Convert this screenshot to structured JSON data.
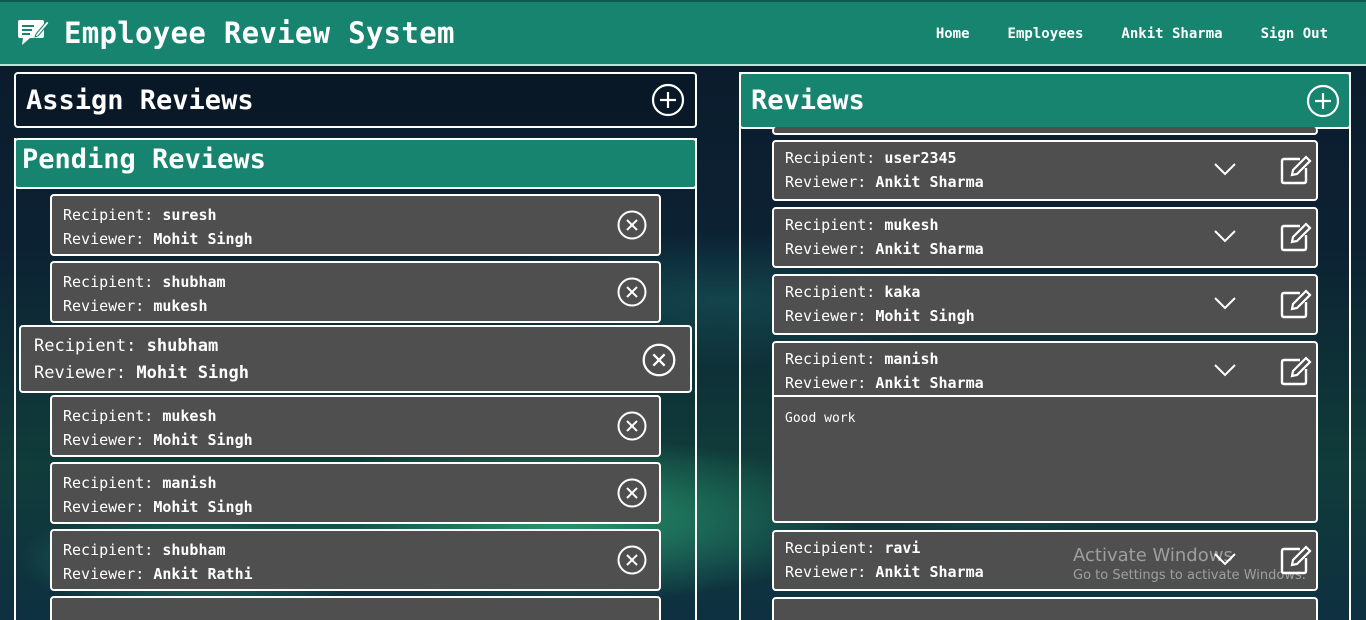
{
  "header": {
    "title": "Employee Review System",
    "nav": [
      "Home",
      "Employees",
      "Ankit Sharma",
      "Sign Out"
    ]
  },
  "assign": {
    "title": "Assign Reviews"
  },
  "pending": {
    "title": "Pending Reviews",
    "recipient_label": "Recipient:",
    "reviewer_label": "Reviewer:",
    "items": [
      {
        "recipient": "suresh",
        "reviewer": "Mohit Singh"
      },
      {
        "recipient": "shubham",
        "reviewer": "mukesh"
      },
      {
        "recipient": "shubham",
        "reviewer": "Mohit Singh"
      },
      {
        "recipient": "mukesh",
        "reviewer": "Mohit Singh"
      },
      {
        "recipient": "manish",
        "reviewer": "Mohit Singh"
      },
      {
        "recipient": "shubham",
        "reviewer": "Ankit Rathi"
      }
    ]
  },
  "reviews": {
    "title": "Reviews",
    "recipient_label": "Recipient:",
    "reviewer_label": "Reviewer:",
    "items": [
      {
        "recipient": "user2345",
        "reviewer": "Ankit Sharma"
      },
      {
        "recipient": "mukesh",
        "reviewer": "Ankit Sharma"
      },
      {
        "recipient": "kaka",
        "reviewer": "Mohit Singh"
      },
      {
        "recipient": "manish",
        "reviewer": "Ankit Sharma",
        "feedback": "Good work"
      },
      {
        "recipient": "ravi",
        "reviewer": "Ankit Sharma"
      }
    ]
  },
  "watermark": {
    "line1": "Activate Windows",
    "line2": "Go to Settings to activate Windows."
  },
  "colors": {
    "navbar": "#17846f",
    "card": "#4f4f4f",
    "reviews_header": "#17846f"
  }
}
